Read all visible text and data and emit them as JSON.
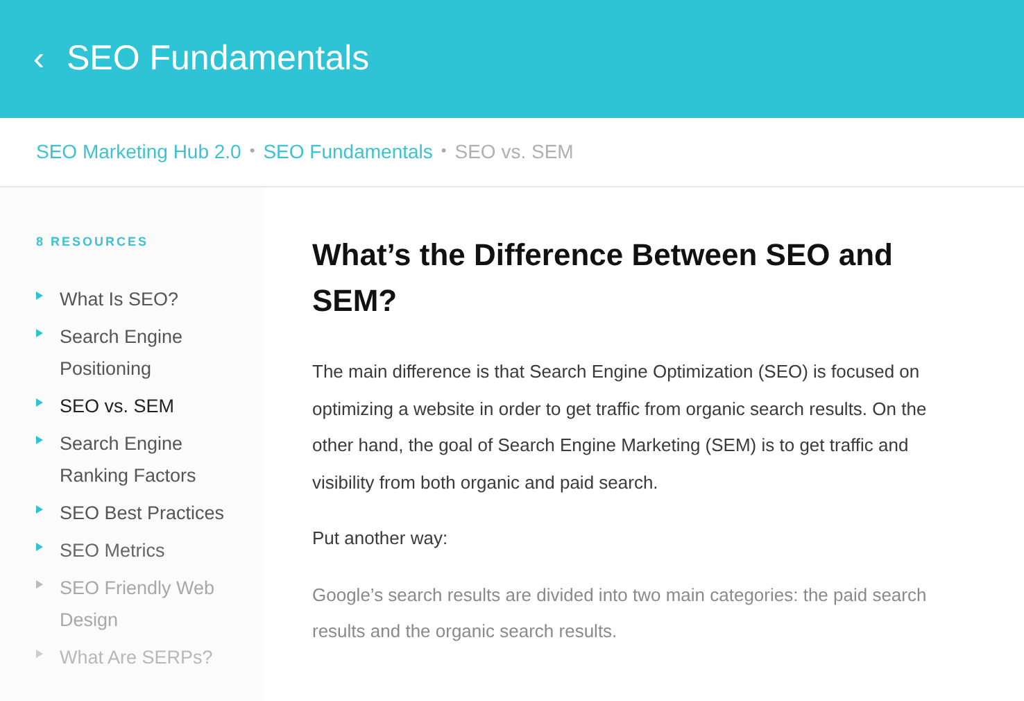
{
  "header": {
    "back": "‹",
    "title": "SEO Fundamentals"
  },
  "breadcrumb": [
    {
      "label": "SEO Marketing Hub 2.0",
      "current": false
    },
    {
      "label": "SEO Fundamentals",
      "current": false
    },
    {
      "label": "SEO vs. SEM",
      "current": true
    }
  ],
  "breadcrumb_separator": "•",
  "sidebar": {
    "heading": "8 RESOURCES",
    "items": [
      {
        "label": "What Is SEO?",
        "selected": false
      },
      {
        "label": "Search Engine Positioning",
        "selected": false
      },
      {
        "label": "SEO vs. SEM",
        "selected": true
      },
      {
        "label": "Search Engine Ranking Factors",
        "selected": false
      },
      {
        "label": "SEO Best Practices",
        "selected": false
      },
      {
        "label": "SEO Metrics",
        "selected": false
      },
      {
        "label": "SEO Friendly Web Design",
        "selected": false
      },
      {
        "label": "What Are SERPs?",
        "selected": false
      }
    ]
  },
  "article": {
    "title": "What’s the Difference Between SEO and SEM?",
    "paragraphs": [
      "The main difference is that Search Engine Optimization (SEO) is focused on optimizing a website in order to get traffic from organic search results. On the other hand, the goal of Search Engine Marketing (SEM) is to get traffic and visibility from both organic and paid search.",
      "Put another way:",
      "Google’s search results are divided into two main categories: the paid search results and the organic search results."
    ]
  }
}
